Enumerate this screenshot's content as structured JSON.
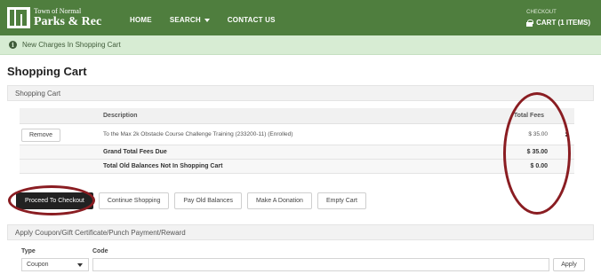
{
  "header": {
    "logo_line1": "Town of Normal",
    "logo_line2": "Parks & Rec",
    "nav": [
      "HOME",
      "SEARCH",
      "CONTACT US"
    ],
    "checkout_label": "CHECKOUT",
    "cart_label": "CART (1 ITEMS)",
    "brand_color": "#4f7e3e"
  },
  "notice": {
    "icon": "info-icon",
    "text": "New Charges In Shopping Cart"
  },
  "page_title": "Shopping Cart",
  "cart_section": {
    "title": "Shopping Cart",
    "columns": [
      "Description",
      "Total Fees"
    ],
    "items": [
      {
        "action": "Remove",
        "description": "To the Max 2k Obstacle Course Challenge Training (233200-11) (Enrolled)",
        "fee": "$ 35.00"
      }
    ],
    "grand_total_label": "Grand Total Fees Due",
    "grand_total_value": "$ 35.00",
    "old_balances_label": "Total Old Balances Not In Shopping Cart",
    "old_balances_value": "$ 0.00"
  },
  "actions": {
    "checkout": "Proceed To Checkout",
    "continue": "Continue Shopping",
    "pay_old": "Pay Old Balances",
    "donate": "Make A Donation",
    "empty": "Empty Cart"
  },
  "coupon": {
    "title": "Apply Coupon/Gift Certificate/Punch Payment/Reward",
    "type_label": "Type",
    "type_value": "Coupon",
    "code_label": "Code",
    "code_value": "",
    "apply": "Apply"
  },
  "annotation_color": "#8a1d22"
}
